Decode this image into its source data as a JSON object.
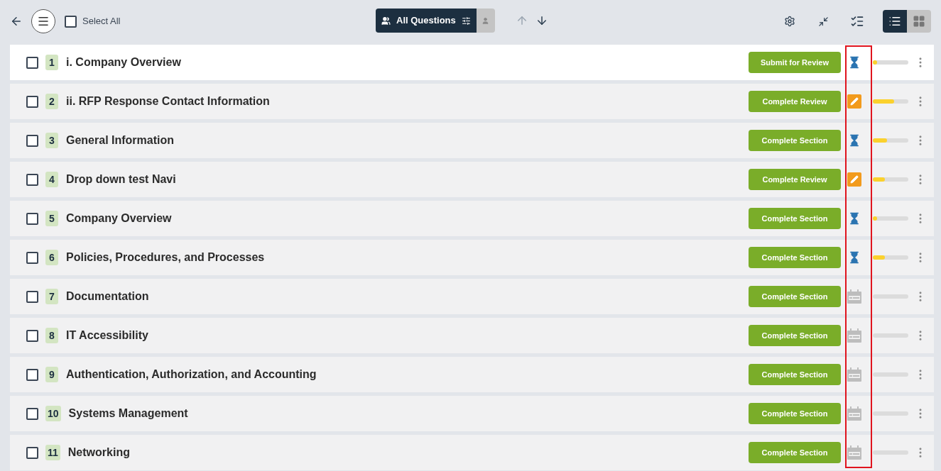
{
  "toolbar": {
    "select_all": {
      "label": "Select All",
      "checked": false
    },
    "filter": {
      "label": "All Questions",
      "selected": true
    },
    "view_mode": [
      {
        "kind": "list",
        "selected": true
      },
      {
        "kind": "grid",
        "selected": false
      }
    ]
  },
  "sections": [
    {
      "number": "1",
      "title": "i. Company Overview",
      "selected": true,
      "checked": false,
      "action": "Submit for Review",
      "kind": "pending",
      "level": 0.12
    },
    {
      "number": "2",
      "title": "ii. RFP Response Contact Information",
      "selected": false,
      "checked": false,
      "action": "Complete Review",
      "kind": "editing",
      "level": 0.6
    },
    {
      "number": "3",
      "title": "General Information",
      "selected": false,
      "checked": false,
      "action": "Complete Section",
      "kind": "pending",
      "level": 0.4
    },
    {
      "number": "4",
      "title": "Drop down test Navi",
      "selected": false,
      "checked": false,
      "action": "Complete Review",
      "kind": "editing",
      "level": 0.33
    },
    {
      "number": "5",
      "title": "Company Overview",
      "selected": false,
      "checked": false,
      "action": "Complete Section",
      "kind": "pending",
      "level": 0.12
    },
    {
      "number": "6",
      "title": "Policies, Procedures, and Processes",
      "selected": false,
      "checked": false,
      "action": "Complete Section",
      "kind": "pending",
      "level": 0.33
    },
    {
      "number": "7",
      "title": "Documentation",
      "selected": false,
      "checked": false,
      "action": "Complete Section",
      "kind": "scheduled",
      "level": 0
    },
    {
      "number": "8",
      "title": "IT Accessibility",
      "selected": false,
      "checked": false,
      "action": "Complete Section",
      "kind": "scheduled",
      "level": 0
    },
    {
      "number": "9",
      "title": "Authentication, Authorization, and Accounting",
      "selected": false,
      "checked": false,
      "action": "Complete Section",
      "kind": "scheduled",
      "level": 0
    },
    {
      "number": "10",
      "title": "Systems Management",
      "selected": false,
      "checked": false,
      "action": "Complete Section",
      "kind": "scheduled",
      "level": 0
    },
    {
      "number": "11",
      "title": "Networking",
      "selected": false,
      "checked": false,
      "action": "Complete Section",
      "kind": "scheduled",
      "level": 0
    }
  ]
}
